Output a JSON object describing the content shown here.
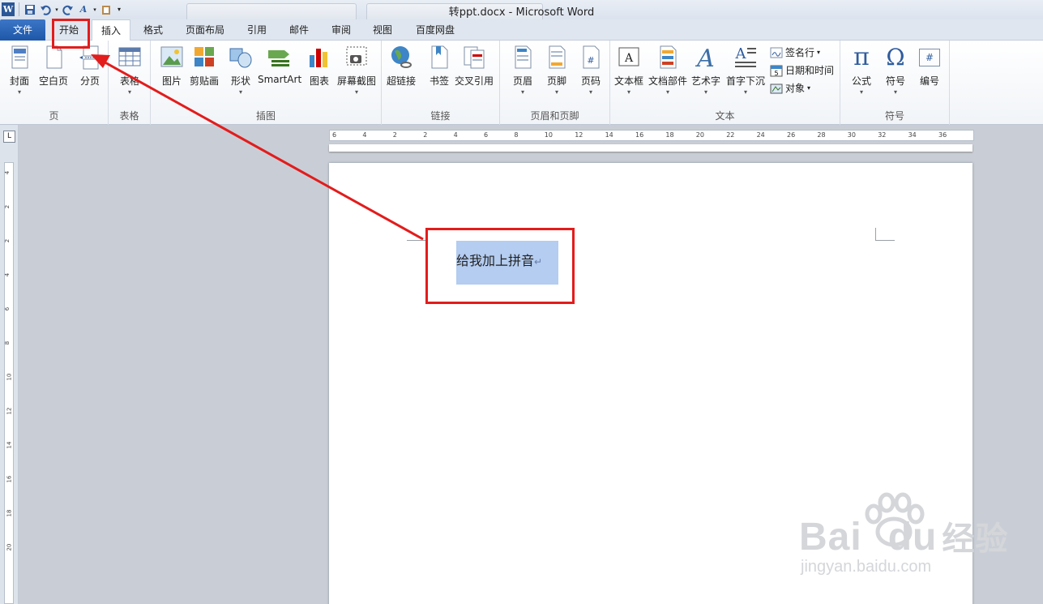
{
  "window": {
    "title": "转ppt.docx - Microsoft Word",
    "active_app_icon": "word-icon",
    "accent": "#2b5797"
  },
  "tabs": {
    "file": "文件",
    "home": "开始",
    "insert": "插入",
    "format": "格式",
    "layout": "页面布局",
    "references": "引用",
    "mailings": "邮件",
    "review": "审阅",
    "view": "视图",
    "baidu_disk": "百度网盘"
  },
  "groups": {
    "pages": {
      "label": "页",
      "cover": "封面",
      "blank": "空白页",
      "break": "分页"
    },
    "tables": {
      "label": "表格",
      "table": "表格"
    },
    "illustrations": {
      "label": "插图",
      "picture": "图片",
      "clipart": "剪贴画",
      "shapes": "形状",
      "smartart": "SmartArt",
      "chart": "图表",
      "screenshot": "屏幕截图"
    },
    "links": {
      "label": "链接",
      "hyperlink": "超链接",
      "bookmark": "书签",
      "crossref": "交叉引用"
    },
    "header_footer": {
      "label": "页眉和页脚",
      "header": "页眉",
      "footer": "页脚",
      "page_number": "页码"
    },
    "text": {
      "label": "文本",
      "textbox": "文本框",
      "quickparts": "文档部件",
      "wordart": "艺术字",
      "dropcap": "首字下沉",
      "signature": "签名行",
      "datetime": "日期和时间",
      "object": "对象"
    },
    "symbols": {
      "label": "符号",
      "equation": "公式",
      "symbol": "符号",
      "number": "编号",
      "pi_glyph": "π",
      "omega_glyph": "Ω",
      "hash_glyph": "#"
    }
  },
  "ruler": {
    "h_ticks": [
      "6",
      "4",
      "2",
      "2",
      "4",
      "6",
      "8",
      "10",
      "12",
      "14",
      "16",
      "18",
      "20",
      "22",
      "24",
      "26",
      "28",
      "30",
      "32",
      "34",
      "36"
    ],
    "v_ticks": [
      "4",
      "2",
      "2",
      "4",
      "6",
      "8",
      "10",
      "12",
      "14",
      "16",
      "18",
      "20"
    ],
    "corner_glyph": "L"
  },
  "document": {
    "text": "给我加上拼音",
    "paragraph_mark": "↵",
    "selection_color": "#b4cdf0"
  },
  "annotation": {
    "color": "#e31c1c"
  },
  "watermark": {
    "brand": "Bai",
    "brand_suffix": "du",
    "cn": "经验",
    "url": "jingyan.baidu.com"
  }
}
